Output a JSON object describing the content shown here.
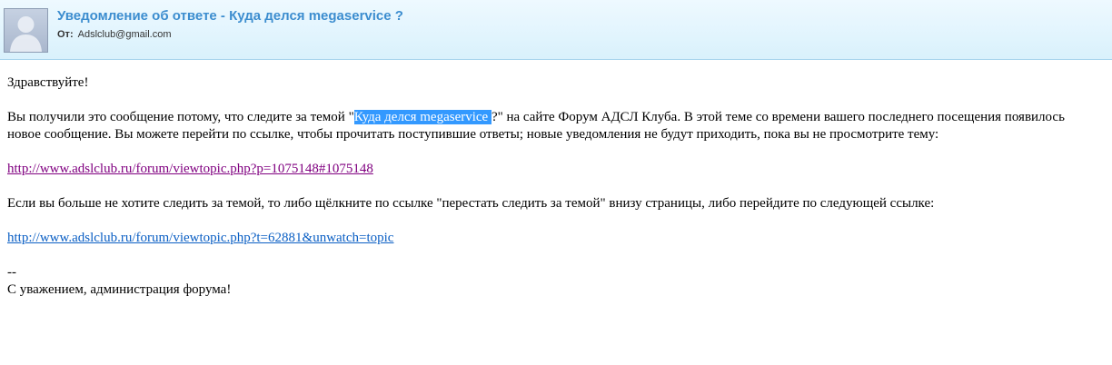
{
  "header": {
    "subject": "Уведомление об ответе - Куда делся megaservice ?",
    "from_label": "От:",
    "from_email": "Adslclub@gmail.com",
    "avatar_icon": "person-silhouette-icon"
  },
  "message": {
    "greeting": "Здравствуйте!",
    "p1_before": "Вы получили это сообщение потому, что следите за темой \"",
    "p1_topic": "Куда делся megaservice ",
    "p1_after": "?\" на сайте Форум АДСЛ Клуба. В этой теме со времени вашего последнего посещения появилось",
    "p1_line2": "новое сообщение. Вы можете перейти по ссылке, чтобы прочитать поступившие ответы; новые уведомления не будут приходить, пока вы не просмотрите тему:",
    "link1": "http://www.adslclub.ru/forum/viewtopic.php?p=1075148#1075148",
    "p2": "Если вы больше не хотите следить за темой, то либо щёлкните по ссылке \"перестать следить за темой\" внизу страницы, либо перейдите по следующей ссылке:",
    "link2": "http://www.adslclub.ru/forum/viewtopic.php?t=62881&unwatch=topic",
    "sig_dash": "--",
    "sig_text": "С уважением, администрация форума!"
  },
  "colors": {
    "header_bg": "#d9f1fc",
    "subject": "#3c8dcf",
    "highlight": "#3399ff",
    "visited_link": "#800080",
    "link": "#0b5fc4"
  }
}
